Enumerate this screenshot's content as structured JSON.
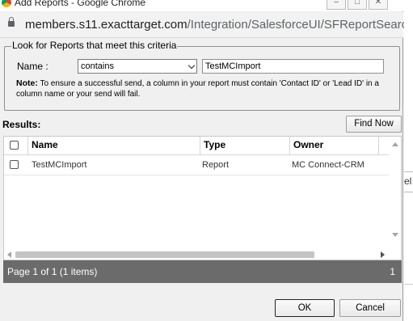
{
  "window": {
    "title": "Add Reports - Google Chrome",
    "url_host": "members.s11.exacttarget.com",
    "url_path": "/Integration/SalesforceUI/SFReportSearc..."
  },
  "criteria": {
    "legend": "Look for Reports that meet this criteria",
    "name_label": "Name :",
    "operator_selected": "contains",
    "search_value": "TestMCImport",
    "note_label": "Note:",
    "note_text": " To ensure a successful send, a column in your report must contain 'Contact ID' or 'Lead ID' in a column name or your send will fail."
  },
  "results": {
    "label": "Results:",
    "find_now": "Find Now",
    "columns": [
      "Name",
      "Type",
      "Owner"
    ],
    "rows": [
      {
        "name": "TestMCImport",
        "type": "Report",
        "owner": "MC Connect-CRM"
      }
    ]
  },
  "pager": {
    "text": "Page 1 of 1 (1 items)",
    "page": "1"
  },
  "footer": {
    "ok": "OK",
    "cancel": "Cancel"
  },
  "background_page": {
    "fragment": "el"
  }
}
